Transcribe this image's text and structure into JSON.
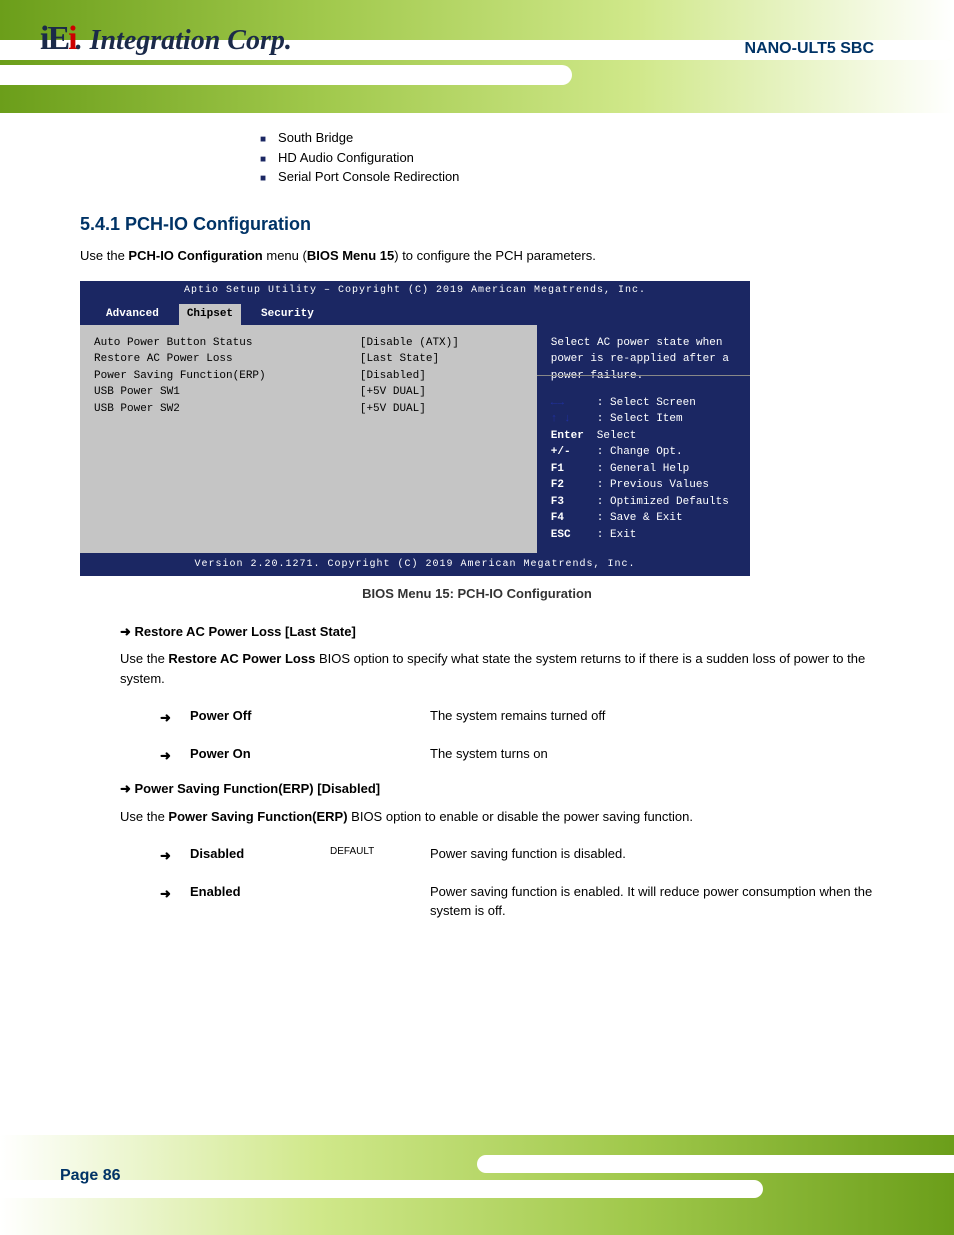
{
  "header": {
    "logo_text": "iEi Integration Corp.",
    "doc_title": "NANO-ULT5 SBC"
  },
  "bullets": [
    "South Bridge",
    "HD Audio Configuration",
    "Serial Port Console Redirection"
  ],
  "section_num": "5.4.1 PCH-IO Configuration",
  "section_intro": "Use the PCH-IO Configuration menu (BIOS Menu 15) to configure the PCH parameters.",
  "bios": {
    "brand": "Aptio Setup Utility – Copyright (C) 2019 American Megatrends, Inc.",
    "tabs": [
      "Advanced",
      "Chipset",
      "Security"
    ],
    "rows": [
      {
        "k": "Auto Power Button Status",
        "v": "[Disable (ATX)]"
      },
      {
        "k": "Restore AC Power Loss",
        "v": "[Last State]"
      },
      {
        "k": "Power Saving Function(ERP)",
        "v": "[Disabled]"
      },
      {
        "k": "USB Power SW1",
        "v": "[+5V DUAL]"
      },
      {
        "k": "USB Power SW2",
        "v": "[+5V DUAL]"
      }
    ],
    "right_hint": "Select AC power state when power is re-applied after a power failure.",
    "help": [
      {
        "sym": "←→",
        "txt": ": Select Screen",
        "cls": "arrow-blue"
      },
      {
        "sym": "↑ ↓",
        "txt": ": Select Item",
        "cls": "arrow-blue"
      },
      {
        "sym": "Enter",
        "txt": "Select",
        "cls": ""
      },
      {
        "sym": "+/-",
        "txt": ": Change Opt.",
        "cls": ""
      },
      {
        "sym": "F1",
        "txt": ": General Help",
        "cls": ""
      },
      {
        "sym": "F2",
        "txt": ": Previous Values",
        "cls": ""
      },
      {
        "sym": "F3",
        "txt": ": Optimized Defaults",
        "cls": ""
      },
      {
        "sym": "F4",
        "txt": ": Save & Exit",
        "cls": ""
      },
      {
        "sym": "ESC",
        "txt": ": Exit",
        "cls": ""
      }
    ],
    "bottom": "Version 2.20.1271. Copyright (C) 2019 American Megatrends, Inc."
  },
  "menu_caption": "BIOS Menu 15: PCH-IO Configuration",
  "options": [
    {
      "title": "Restore AC Power Loss [Last State]",
      "desc": "Use the Restore AC Power Loss BIOS option to specify what state the system returns to if there is a sudden loss of power to the system.",
      "subs": [
        {
          "label": "Power Off",
          "def": "",
          "text": "The system remains turned off"
        },
        {
          "label": "Power On",
          "def": "",
          "text": "The system turns on"
        }
      ]
    },
    {
      "title": "Power Saving Function(ERP) [Disabled]",
      "desc": "Use the Power Saving Function(ERP) BIOS option to enable or disable the power saving function.",
      "subs": [
        {
          "label": "Disabled",
          "def": "DEFAULT",
          "text": "Power saving function is disabled."
        },
        {
          "label": "Enabled",
          "def": "",
          "text": "Power saving function is enabled. It will reduce power consumption when the system is off."
        }
      ]
    }
  ],
  "page_number": "Page 86"
}
